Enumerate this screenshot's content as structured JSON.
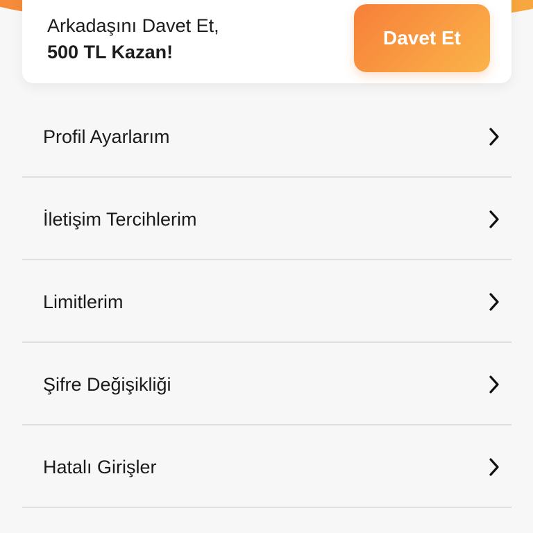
{
  "invite": {
    "line1": "Arkadaşını Davet Et,",
    "line2": "500 TL Kazan!",
    "button_label": "Davet Et"
  },
  "colors": {
    "accent_start": "#f77f3a",
    "accent_end": "#fbb449",
    "background": "#f7f7f7",
    "divider": "#e0e0e0"
  },
  "menu": {
    "items": [
      {
        "label": "Profil Ayarlarım",
        "icon": "chevron-right-icon"
      },
      {
        "label": "İletişim Tercihlerim",
        "icon": "chevron-right-icon"
      },
      {
        "label": "Limitlerim",
        "icon": "chevron-right-icon"
      },
      {
        "label": "Şifre Değişikliği",
        "icon": "chevron-right-icon"
      },
      {
        "label": "Hatalı Girişler",
        "icon": "chevron-right-icon"
      }
    ]
  }
}
